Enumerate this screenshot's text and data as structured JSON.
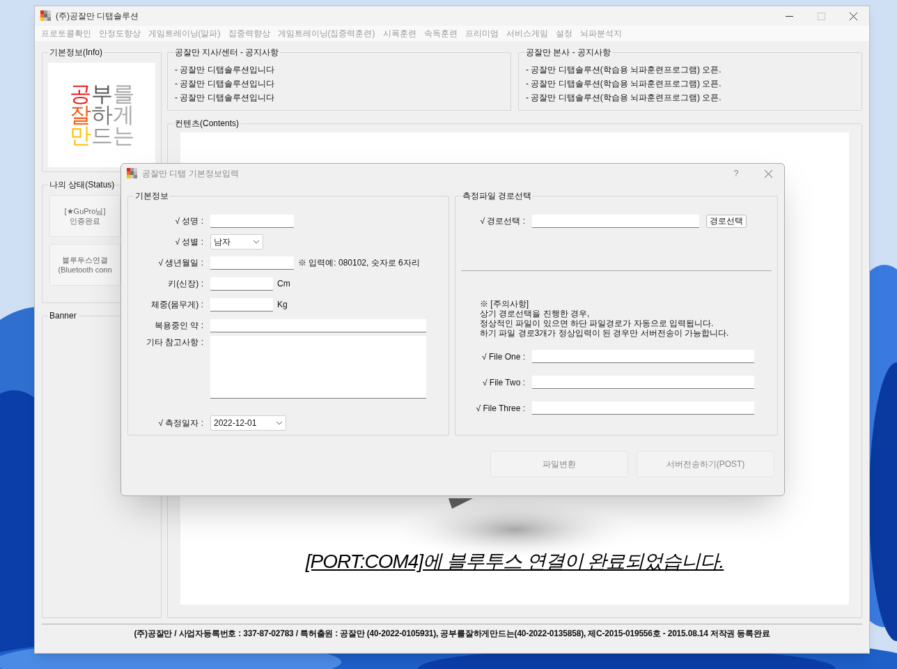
{
  "window": {
    "title": "(주)공잘만 디탭솔루션",
    "controls": [
      {
        "kind": "minimize",
        "disabled": false
      },
      {
        "kind": "maximize",
        "disabled": true
      },
      {
        "kind": "close",
        "disabled": false
      }
    ]
  },
  "menu": [
    "프로토콜확인",
    "안정도향상",
    "게임트레이닝(알파)",
    "집중력향상",
    "게임트레이닝(집중력훈련)",
    "시폭훈련",
    "속독훈련",
    "프리미엄",
    "서비스게임",
    "설정",
    "뇌파분석지"
  ],
  "info": {
    "title": "기본정보(Info)",
    "logo": [
      [
        {
          "text": "공",
          "color": "#ee1c1c"
        },
        {
          "text": "부",
          "color": "#555555"
        },
        {
          "text": "를",
          "color": "#a8a8a8"
        }
      ],
      [
        {
          "text": "잘",
          "color": "#f45a12"
        },
        {
          "text": "하",
          "color": "#777777"
        },
        {
          "text": "게",
          "color": "#a8a8a8"
        }
      ],
      [
        {
          "text": "만",
          "color": "#ffc20e"
        },
        {
          "text": "드",
          "color": "#9a9a9a"
        },
        {
          "text": "는",
          "color": "#a8a8a8"
        }
      ]
    ]
  },
  "status": {
    "title": "나의 상태(Status)",
    "buttons": [
      {
        "lines": [
          "[★GuPro님]",
          "인증완료"
        ]
      },
      {
        "lines": [
          "블루투스연결",
          "(Bluetooth conn"
        ]
      }
    ]
  },
  "banner": {
    "title": "Banner"
  },
  "notices": [
    {
      "title": "공잘만 지사/센터 - 공지사항",
      "lines": [
        "- 공잘만 디탭솔루션입니다",
        "- 공잘만 디탭솔루션입니다",
        "- 공잘만 디탭솔루션입니다"
      ]
    },
    {
      "title": "공잘만 본사 - 공지사항",
      "lines": [
        "- 공잘만 디탭솔루션(학습용 뇌파훈련프로그램) 오픈.",
        "- 공잘만 디탭솔루션(학습용 뇌파훈련프로그램) 오픈.",
        "- 공잘만 디탭솔루션(학습용 뇌파훈련프로그램) 오픈."
      ]
    }
  ],
  "contents": {
    "title": "컨텐츠(Contents)",
    "message": "[PORT:COM4]에 블루투스 연결이 완료되었습니다."
  },
  "footer": "(주)공잘만 / 사업자등록번호 : 337-87-02783 / 특허출원 : 공잘만 (40-2022-0105931), 공부를잘하게만드는(40-2022-0135858), 제C-2015-019556호 - 2015.08.14 저작권 등록완료",
  "dialog": {
    "title": "공잘만 디탭 기본정보입력",
    "help": "?",
    "basic": {
      "title": "기본정보",
      "fields": [
        {
          "kind": "text",
          "label": "√ 성명 :"
        },
        {
          "kind": "select",
          "label": "√ 성별 :",
          "value": "남자"
        },
        {
          "kind": "text",
          "label": "√ 생년월일 :",
          "note": "※ 입력예: 080102, 숫자로 6자리"
        },
        {
          "kind": "short",
          "label": "키(신장) :",
          "note": "Cm"
        },
        {
          "kind": "short",
          "label": "체중(몸무게) :",
          "note": "Kg"
        },
        {
          "kind": "long",
          "label": "복용중인 약 :"
        },
        {
          "kind": "area",
          "label": "기타 참고사항 :"
        },
        {
          "kind": "select",
          "label": "√ 측정일자 :",
          "value": "2022-12-01"
        }
      ]
    },
    "files": {
      "title": "측정파일 경로선택",
      "path_label": "√ 경로선택 :",
      "path_button": "경로선택",
      "notice": [
        "※ [주의사항]",
        "상기 경로선택을 진행한 경우,",
        "정상적인 파일이 있으면 하단 파일경로가 자동으로 입력됩니다.",
        "하기 파일 경로3개가 정상입력이 된 경우만 서버전송이 가능합니다."
      ],
      "fields": [
        "√ File One :",
        "√ File Two :",
        "√ File Three :"
      ]
    },
    "buttons": [
      {
        "label": "파일변환",
        "disabled": true
      },
      {
        "label": "서버전송하기(POST)",
        "disabled": true
      }
    ]
  }
}
